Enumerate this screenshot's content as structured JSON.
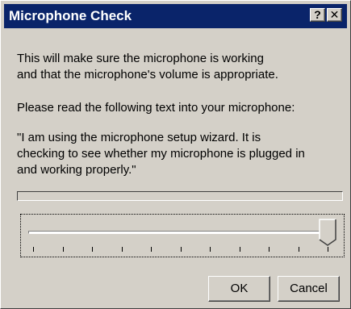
{
  "window": {
    "title": "Microphone Check",
    "help_label": "?",
    "close_label": "✕"
  },
  "content": {
    "intro": "This will make sure the microphone is working\nand that the microphone's volume is appropriate.",
    "instruction": "Please read the following text into your microphone:",
    "quote": "\"I am using the microphone setup wizard. It is\nchecking to see whether my microphone is plugged in\nand working properly.\""
  },
  "level_meter": {
    "level": 0
  },
  "volume_slider": {
    "value": 1.0,
    "tick_count": 11
  },
  "buttons": {
    "ok": "OK",
    "cancel": "Cancel"
  },
  "colors": {
    "titlebar": "#0a246a",
    "face": "#d4d0c8"
  }
}
